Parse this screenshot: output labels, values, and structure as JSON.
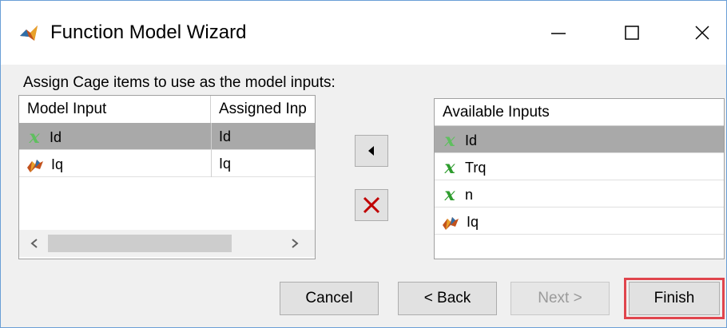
{
  "window": {
    "title": "Function Model Wizard",
    "icon": "matlab-icon",
    "controls": {
      "minimize": "minimize-icon",
      "maximize": "maximize-icon",
      "close": "close-icon"
    }
  },
  "prompt": "Assign Cage items to use as the model inputs:",
  "model_inputs_table": {
    "columns": [
      "Model Input",
      "Assigned Inp"
    ],
    "rows": [
      {
        "icon": "variable-icon",
        "model_input": "Id",
        "assigned_input": "Id",
        "selected": true
      },
      {
        "icon": "feature-icon",
        "model_input": "Iq",
        "assigned_input": "Iq",
        "selected": false
      }
    ]
  },
  "available_inputs": {
    "header": "Available Inputs",
    "items": [
      {
        "icon": "variable-icon",
        "label": "Id",
        "selected": true
      },
      {
        "icon": "variable-icon",
        "label": "Trq",
        "selected": false
      },
      {
        "icon": "variable-icon",
        "label": "n",
        "selected": false
      },
      {
        "icon": "feature-icon",
        "label": "Iq",
        "selected": false
      }
    ]
  },
  "icons": {
    "variable_glyph": "x"
  },
  "buttons": {
    "cancel": "Cancel",
    "back": "< Back",
    "next": "Next >",
    "finish": "Finish"
  },
  "colors": {
    "variable_icon": "#2e9c2e",
    "selection": "#a9a9a9",
    "highlight": "#e0454d",
    "remove_x": "#c00000"
  }
}
